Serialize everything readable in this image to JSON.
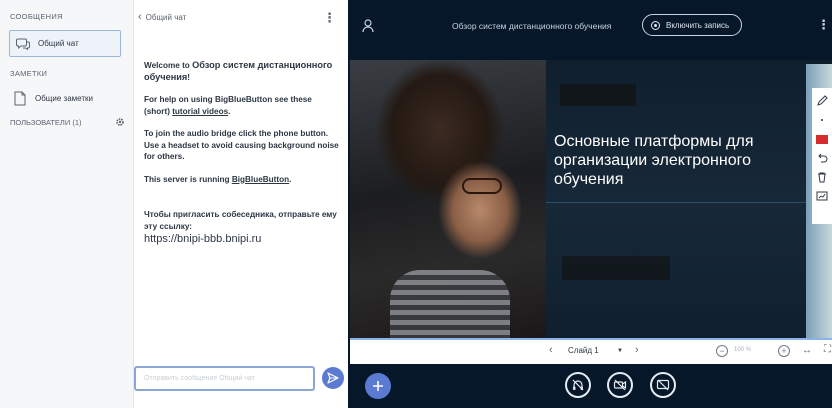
{
  "sidebar": {
    "messages_heading": "СООБЩЕНИЯ",
    "public_chat_label": "Общий чат",
    "notes_heading": "ЗАМЕТКИ",
    "shared_notes_label": "Общие заметки",
    "users_heading": "ПОЛЬЗОВАТЕЛИ (1)"
  },
  "chat": {
    "header_title": "Общий чат",
    "welcome_prefix": "Welcome to ",
    "welcome_name": "Обзор систем дистанционного обучения",
    "welcome_suffix": "!",
    "help_prefix": "For help on using BigBlueButton see these (short) ",
    "help_link": "tutorial videos",
    "help_suffix": ".",
    "audio_text": "To join the audio bridge click the phone button. Use a headset to avoid causing background noise for others.",
    "server_prefix": "This server is running ",
    "server_link": "BigBlueButton",
    "server_suffix": ".",
    "invite_text": "Чтобы пригласить собеседника, отправьте ему эту ссылку:",
    "invite_url": "https://bnipi-bbb.bnipi.ru",
    "input_placeholder": "Отправить сообщение Общий чат"
  },
  "topbar": {
    "meeting_title": "Обзор систем дистанционного обучения",
    "record_label": "Включить запись"
  },
  "presentation": {
    "slide_text": "Основные платформы для организации электронного обучения",
    "slide_selector": "Слайд 1",
    "zoom_level": "100 %"
  },
  "colors": {
    "accent": "#5b7bd3",
    "dark_bg": "#06172a",
    "annotation_red": "#d62c2c"
  }
}
